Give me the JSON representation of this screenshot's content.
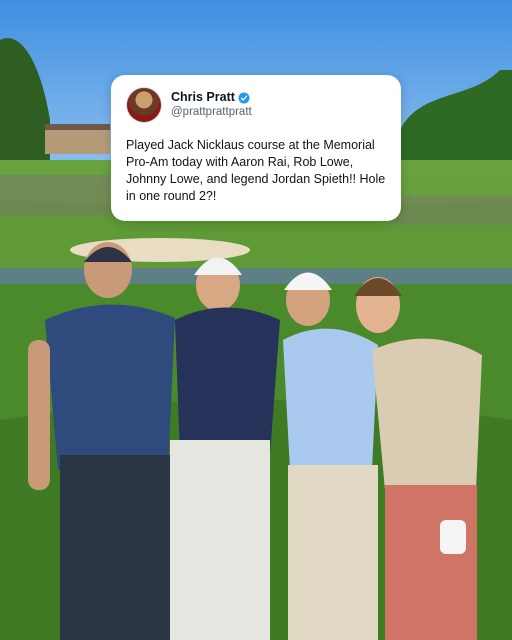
{
  "tweet": {
    "display_name": "Chris Pratt",
    "handle": "@prattprattpratt",
    "text": "Played Jack Nicklaus course at the Memorial Pro-Am today with Aaron Rai, Rob Lowe, Johnny Lowe, and legend Jordan Spieth!! Hole in one round 2?!",
    "avatar_icon": "profile-avatar",
    "verified_icon": "verified-badge-icon",
    "accent_color": "#1d9bf0"
  }
}
